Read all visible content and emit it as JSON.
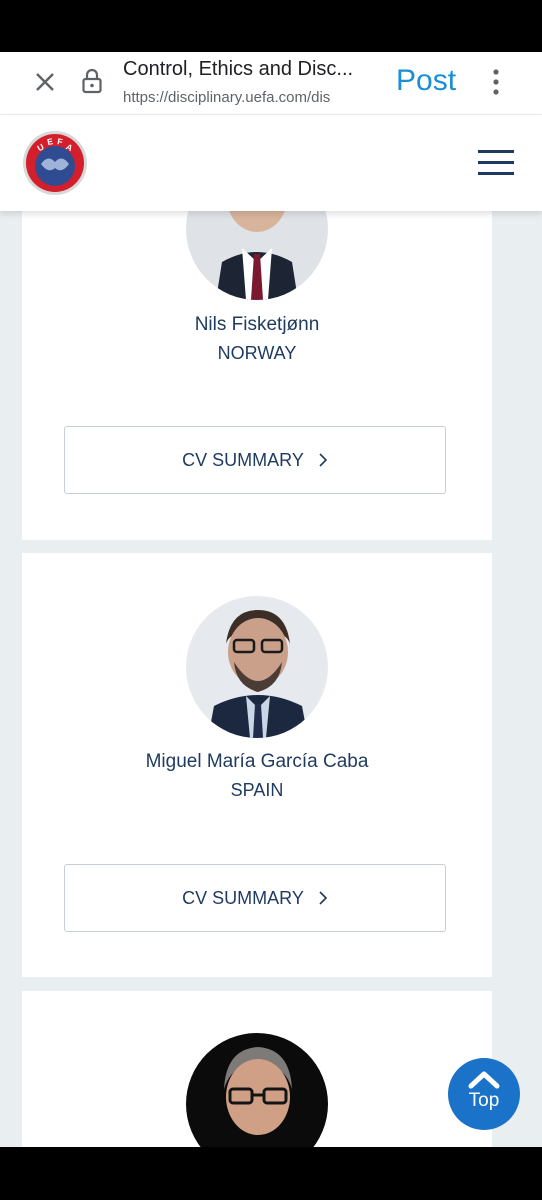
{
  "browser": {
    "title": "Control, Ethics and Disc...",
    "url": "https://disciplinary.uefa.com/dis",
    "post_label": "Post",
    "icons": [
      "close-icon",
      "lock-icon",
      "more-vertical-icon"
    ]
  },
  "site": {
    "logo_text": "UEFA",
    "menu_icon": "hamburger-menu-icon",
    "accent_color": "#1f3a5f"
  },
  "members": [
    {
      "name": "Nils Fisketjønn",
      "country": "NORWAY",
      "cv_label": "CV SUMMARY"
    },
    {
      "name": "Miguel María García Caba",
      "country": "SPAIN",
      "cv_label": "CV SUMMARY"
    },
    {
      "name": "",
      "country": "",
      "cv_label": ""
    }
  ],
  "scroll_top": {
    "label": "Top",
    "color": "#1a73c8"
  }
}
